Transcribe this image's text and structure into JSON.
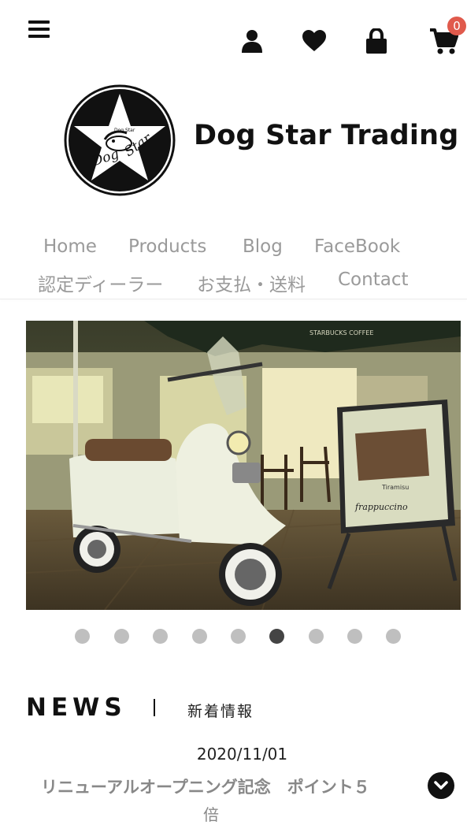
{
  "header": {
    "menu_icon": "hamburger-menu-icon",
    "icons": [
      "user-icon",
      "heart-icon",
      "lock-icon",
      "cart-icon"
    ],
    "cart_count": "0",
    "badge_color": "#e05a4c"
  },
  "brand": {
    "name": "Dog Star Trading",
    "logo_text_small": "Dog Star",
    "logo_text_script": "Dog Star"
  },
  "nav": {
    "items": [
      "Home",
      "Products",
      "Blog",
      "FaceBook",
      "認定ディーラー",
      "お支払・送料",
      "Contact"
    ]
  },
  "slider": {
    "total": 9,
    "active_index": 5,
    "sign_text": "Tiramisu",
    "sign_script": "frappuccino",
    "awning_text": "STARBUCKS COFFEE"
  },
  "news": {
    "heading": "NEWS",
    "subheading": "新着情報",
    "date": "2020/11/01",
    "title": "リニューアルオープニング記念　ポイント５",
    "title_cont": "倍"
  }
}
